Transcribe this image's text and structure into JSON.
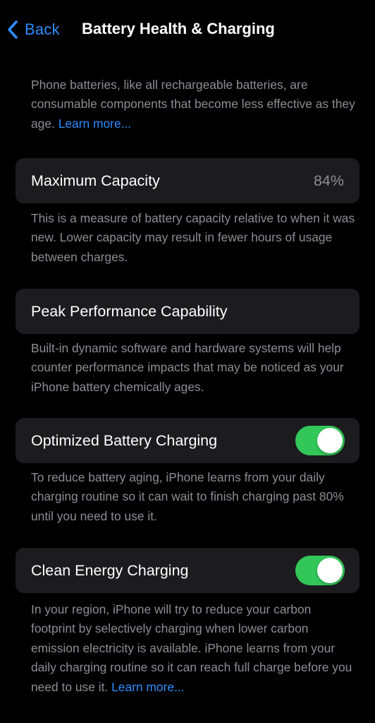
{
  "nav": {
    "back_label": "Back",
    "title": "Battery Health & Charging"
  },
  "intro": {
    "text": "Phone batteries, like all rechargeable batteries, are consumable components that become less effective as they age.",
    "link": "Learn more..."
  },
  "maximum_capacity": {
    "label": "Maximum Capacity",
    "value": "84%",
    "description": "This is a measure of battery capacity relative to when it was new. Lower capacity may result in fewer hours of usage between charges."
  },
  "peak_performance": {
    "label": "Peak Performance Capability",
    "description": "Built-in dynamic software and hardware systems will help counter performance impacts that may be noticed as your iPhone battery chemically ages."
  },
  "optimized_charging": {
    "label": "Optimized Battery Charging",
    "enabled": true,
    "description": "To reduce battery aging, iPhone learns from your daily charging routine so it can wait to finish charging past 80% until you need to use it."
  },
  "clean_energy_charging": {
    "label": "Clean Energy Charging",
    "enabled": true,
    "description": "In your region, iPhone will try to reduce your carbon footprint by selectively charging when lower carbon emission electricity is available. iPhone learns from your daily charging routine so it can reach full charge before you need to use it.",
    "link": "Learn more..."
  },
  "colors": {
    "background": "#000000",
    "card": "#1c1c1e",
    "accent": "#2f8cff",
    "toggle_on": "#33c759",
    "secondary_text": "#8d8d93"
  },
  "icons": {
    "back": "chevron-left-icon"
  }
}
